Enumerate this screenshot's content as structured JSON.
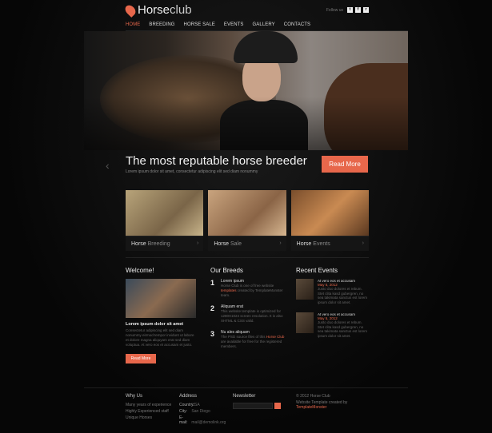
{
  "header": {
    "logo_bold": "Horse",
    "logo_thin": "club",
    "follow_label": "Follow us",
    "social_icons": [
      "twitter-icon",
      "facebook-icon",
      "rss-icon"
    ],
    "social_glyphs": [
      "t",
      "f",
      "r"
    ]
  },
  "nav": {
    "items": [
      "HOME",
      "BREEDING",
      "HORSE SALE",
      "EVENTS",
      "GALLERY",
      "CONTACTS"
    ],
    "active": "HOME"
  },
  "hero": {
    "title": "The most reputable horse breeder",
    "subtitle": "Lorem ipsum dolor sit amet, consectetur adipiscing elit sed diam nonummy",
    "button": "Read More",
    "prev_arrow": "‹"
  },
  "tiles": [
    {
      "bold": "Horse",
      "rest": "Breeding",
      "chevron": "›"
    },
    {
      "bold": "Horse",
      "rest": "Sale",
      "chevron": "›"
    },
    {
      "bold": "Horse",
      "rest": "Events",
      "chevron": "›"
    }
  ],
  "welcome": {
    "heading": "Welcome!",
    "strong": "Lorem ipsum dolor sit amet",
    "body": "Consectetur adipiscing elit sed diam nonummy eirmod tempor invidunt ut labore et dolore magna aliquyam erat sed diam voluptua. At vero eos et accusam et justo.",
    "button": "Read More"
  },
  "breeds": {
    "heading": "Our Breeds",
    "items": [
      {
        "num": "1",
        "title": "Lorem ipsum",
        "text_a": "Horse Club is one of free website",
        "text_hl": "templates",
        "text_b": "created by TemplateMonster team."
      },
      {
        "num": "2",
        "title": "Aliquam erat",
        "text_a": "This website template is optimized for 1280X1024 screen resolution. It is also XHTML & CSS valid.",
        "text_hl": "",
        "text_b": ""
      },
      {
        "num": "3",
        "title": "Nu ales aliquam",
        "text_a": "The PSD source files of this",
        "text_hl": "Horse Club",
        "text_b": "are available for free for the registered members."
      }
    ]
  },
  "events": {
    "heading": "Recent Events",
    "items": [
      {
        "title": "At vero eos et accusam",
        "date": "May 5, 2012",
        "body": "Justo duo dolores et rebum. Stet clita kasd gubergren, no sea takimata sanctus est lorem ipsum dolor sit amet."
      },
      {
        "title": "At vero eos et accusam",
        "date": "May 5, 2012",
        "body": "Justo duo dolores et rebum. Stet clita kasd gubergren, no sea takimata sanctus est lorem ipsum dolor sit amet."
      }
    ]
  },
  "footer": {
    "why_heading": "Why Us",
    "why_items": [
      "Many years of experience",
      "Highly Experienced staff",
      "Unique Horses"
    ],
    "address_heading": "Address",
    "address_rows": [
      {
        "k": "Country:",
        "v": "USA"
      },
      {
        "k": "City:",
        "v": "San Diego"
      },
      {
        "k": "E-mail:",
        "v": "mail@demolink.org"
      }
    ],
    "news_heading": "Newsletter",
    "copyright": "© 2012 Horse Club",
    "credit_a": "Website Template created by",
    "credit_hl": "TemplateMonster"
  },
  "colors": {
    "accent": "#e7674b",
    "background": "#0b0b0b"
  }
}
